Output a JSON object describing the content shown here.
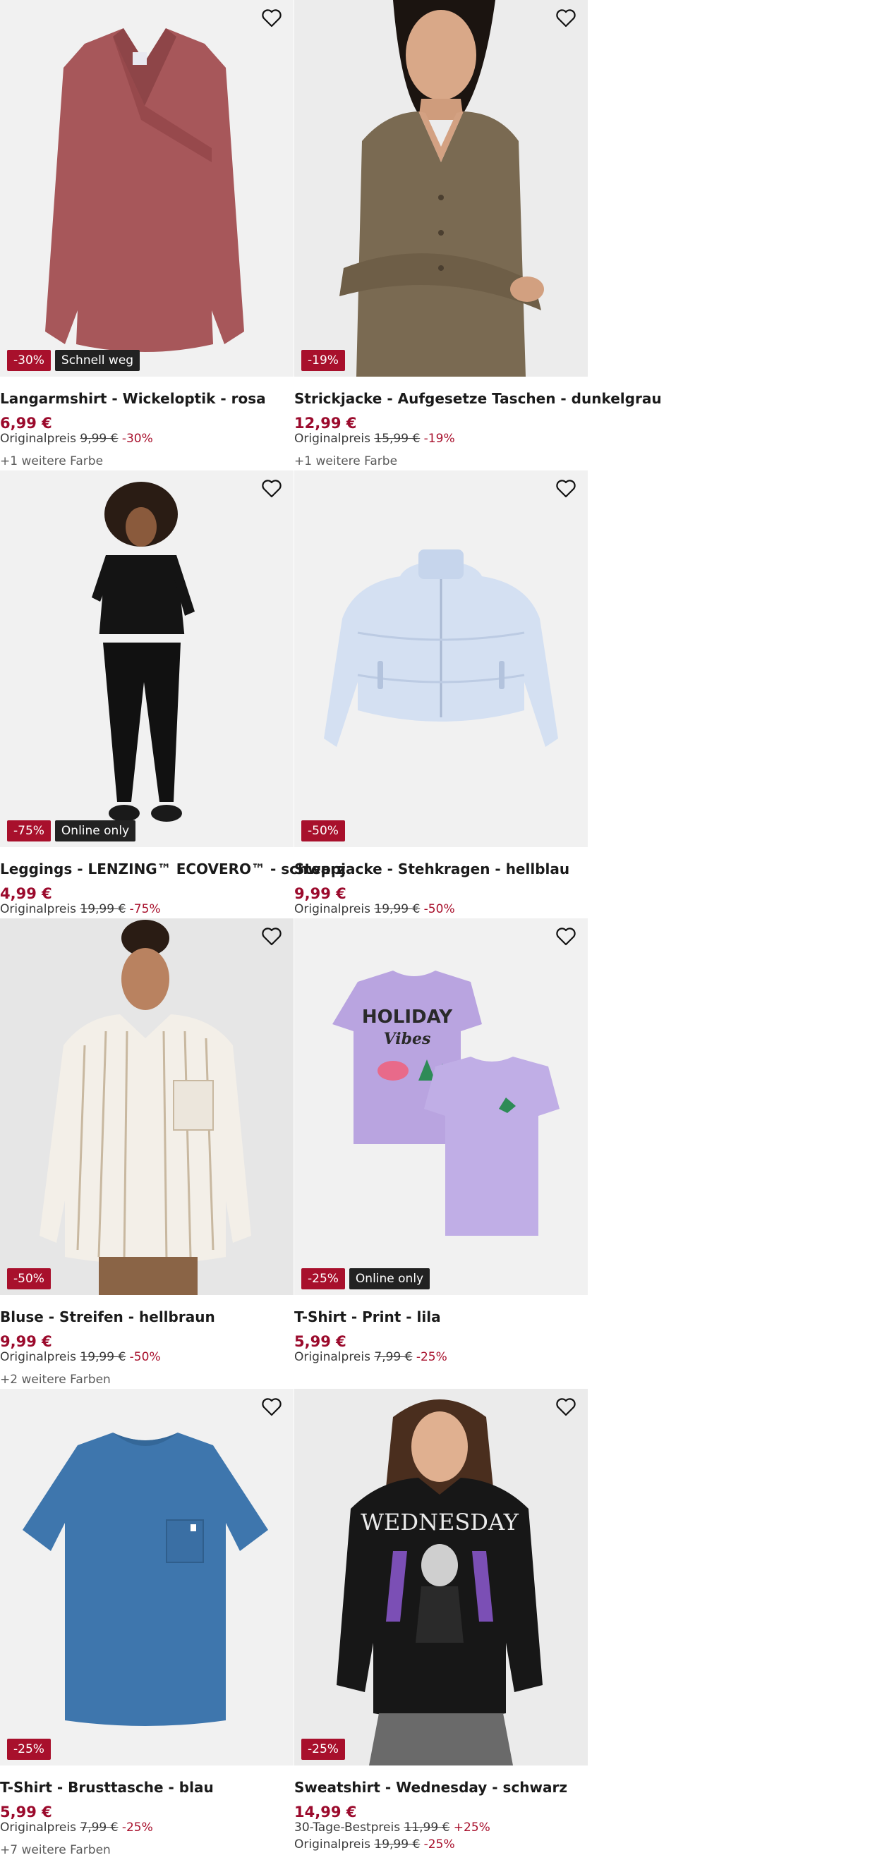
{
  "products": [
    {
      "title": "Langarmshirt - Wickeloptik - rosa",
      "price": "6,99 €",
      "original_label": "Originalpreis",
      "original_price": "9,99 €",
      "discount": "-30%",
      "badge_discount": "-30%",
      "badge_extra": "Schnell weg",
      "more_colors": "+1 weitere Farbe",
      "image": "pink-wrap-longsleeve"
    },
    {
      "title": "Strickjacke - Aufgesetze Taschen - dunkelgrau",
      "price": "12,99 €",
      "original_label": "Originalpreis",
      "original_price": "15,99 €",
      "discount": "-19%",
      "badge_discount": "-19%",
      "badge_extra": "",
      "more_colors": "+1 weitere Farbe",
      "image": "model-taupe-cardigan"
    },
    {
      "title": "Leggings - LENZING™ ECOVERO™ - schwarz",
      "price": "4,99 €",
      "original_label": "Originalpreis",
      "original_price": "19,99 €",
      "discount": "-75%",
      "badge_discount": "-75%",
      "badge_extra": "Online only",
      "more_colors": "",
      "image": "model-black-leggings"
    },
    {
      "title": "Steppjacke - Stehkragen - hellblau",
      "price": "9,99 €",
      "original_label": "Originalpreis",
      "original_price": "19,99 €",
      "discount": "-50%",
      "badge_discount": "-50%",
      "badge_extra": "",
      "more_colors": "",
      "image": "light-blue-puffer-jacket"
    },
    {
      "title": "Bluse - Streifen - hellbraun",
      "price": "9,99 €",
      "original_label": "Originalpreis",
      "original_price": "19,99 €",
      "discount": "-50%",
      "badge_discount": "-50%",
      "badge_extra": "",
      "more_colors": "+2 weitere Farben",
      "image": "model-striped-blouse"
    },
    {
      "title": "T-Shirt - Print - lila",
      "price": "5,99 €",
      "original_label": "Originalpreis",
      "original_price": "7,99 €",
      "discount": "-25%",
      "badge_discount": "-25%",
      "badge_extra": "Online only",
      "more_colors": "",
      "image": "lilac-print-tshirt",
      "print_text_1": "HOLIDAY",
      "print_text_2": "Vibes"
    },
    {
      "title": "T-Shirt - Brusttasche - blau",
      "price": "5,99 €",
      "original_label": "Originalpreis",
      "original_price": "7,99 €",
      "discount": "-25%",
      "badge_discount": "-25%",
      "badge_extra": "",
      "more_colors": "+7 weitere Farben",
      "image": "blue-pocket-tshirt"
    },
    {
      "title": "Sweatshirt - Wednesday - schwarz",
      "price": "14,99 €",
      "ref_label": "30-Tage-Bestpreis",
      "ref_price": "11,99 €",
      "ref_pct": "+25%",
      "original_label": "Originalpreis",
      "original_price": "19,99 €",
      "discount": "-25%",
      "badge_discount": "-25%",
      "badge_extra": "",
      "more_colors": "",
      "image": "model-wednesday-sweatshirt",
      "print_text_1": "WEDNESDAY"
    }
  ],
  "colors": {
    "price": "#9b0a2c",
    "discount_badge": "#a8102c",
    "info_badge": "#222222"
  },
  "icons": {
    "wishlist": "heart-outline-icon"
  }
}
